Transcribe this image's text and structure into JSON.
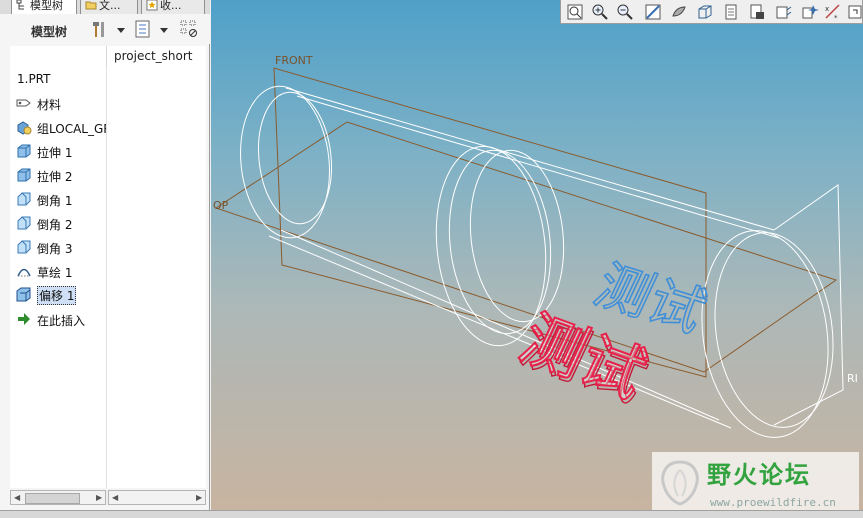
{
  "tabs": [
    {
      "label": "模型树",
      "active": true
    },
    {
      "label": "文...",
      "active": false
    },
    {
      "label": "收...",
      "active": false
    }
  ],
  "toolbar": {
    "label": "模型树"
  },
  "tree": {
    "column_header": "project_short",
    "root_label": "1.PRT",
    "items": [
      {
        "label": "材料",
        "icon": "material-icon"
      },
      {
        "label": "组LOCAL_GR",
        "icon": "group-icon"
      },
      {
        "label": "拉伸 1",
        "icon": "extrude-icon"
      },
      {
        "label": "拉伸 2",
        "icon": "extrude-icon"
      },
      {
        "label": "倒角 1",
        "icon": "chamfer-icon"
      },
      {
        "label": "倒角 2",
        "icon": "chamfer-icon"
      },
      {
        "label": "倒角 3",
        "icon": "chamfer-icon"
      },
      {
        "label": "草绘 1",
        "icon": "sketch-icon"
      },
      {
        "label": "偏移 1",
        "icon": "offset-icon",
        "selected": true
      },
      {
        "label": "在此插入",
        "icon": "insert-arrow-icon"
      }
    ]
  },
  "viewport": {
    "plane_labels": {
      "front": "FRONT",
      "top": "OP",
      "right": "RI"
    },
    "text_feature": "测试",
    "colors": {
      "wireframe": "#ffffff",
      "datum_plane": "#8b5a2b",
      "blue_text": "#3f8fd8",
      "red_text": "#e8204a"
    }
  },
  "view_toolbar": {
    "icons": [
      "refit-icon",
      "zoom-in-icon",
      "zoom-out-icon",
      "repaint-icon",
      "display-style-icon",
      "saved-views-icon",
      "layers-icon",
      "view-manager-icon",
      "datum-display-icon",
      "spin-center-icon",
      "annotation-display-icon",
      "datum-point-icon"
    ]
  },
  "watermark": {
    "title": "野火论坛",
    "url": "www.proewildfire.cn"
  }
}
